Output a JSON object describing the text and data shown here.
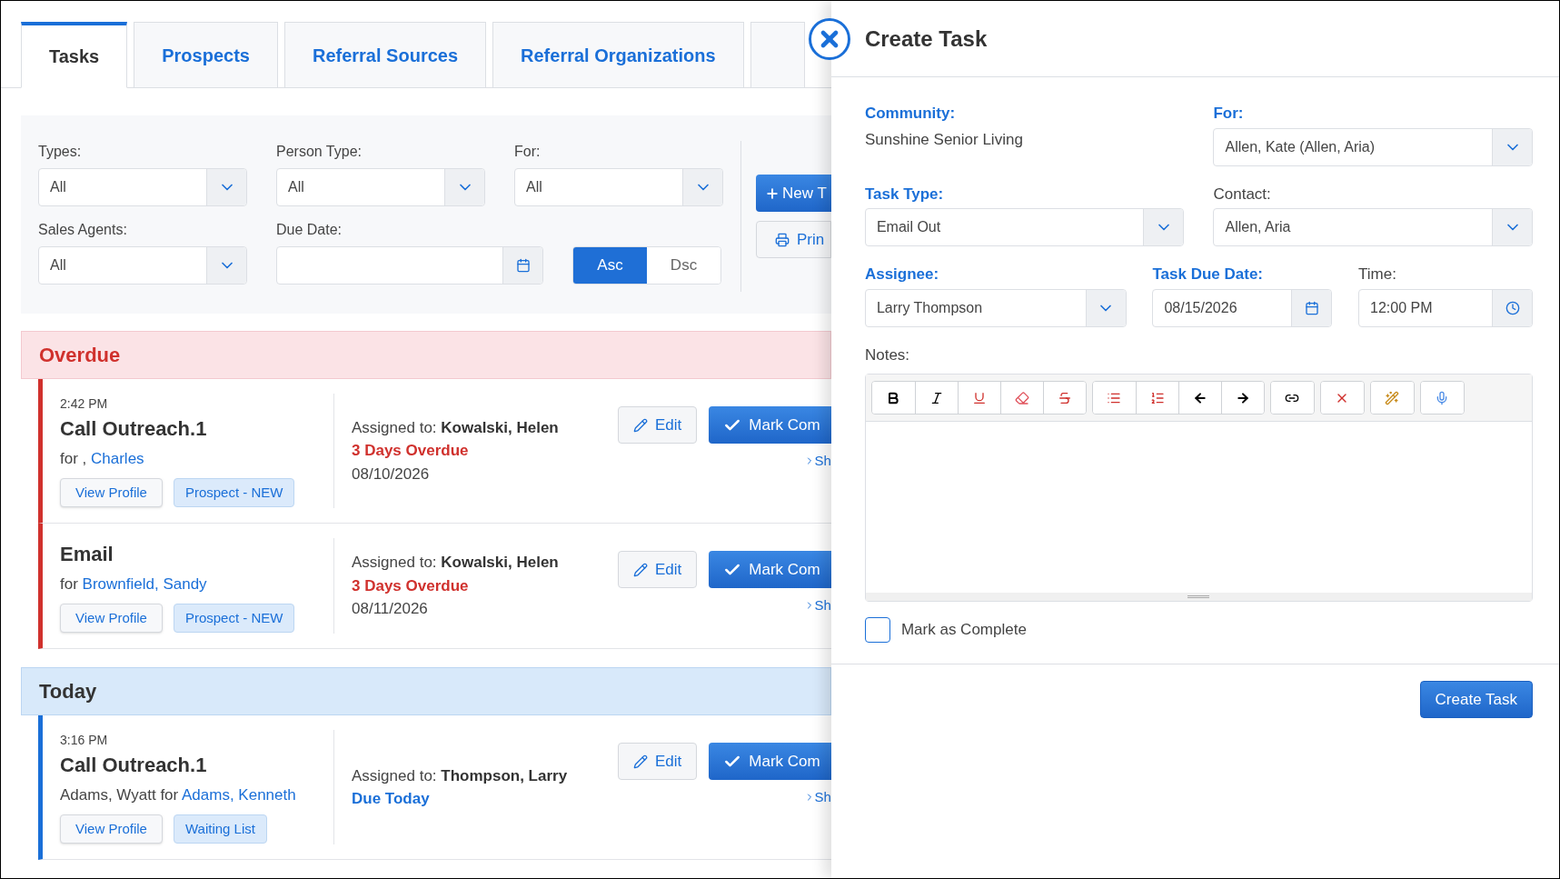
{
  "tabs": [
    {
      "label": "Tasks",
      "selected": true
    },
    {
      "label": "Prospects",
      "selected": false
    },
    {
      "label": "Referral Sources",
      "selected": false
    },
    {
      "label": "Referral Organizations",
      "selected": false
    }
  ],
  "filters": [
    {
      "kind": "select",
      "label": "Types:",
      "value": "All"
    },
    {
      "kind": "select",
      "label": "Person Type:",
      "value": "All"
    },
    {
      "kind": "select",
      "label": "For:",
      "value": "All"
    },
    {
      "kind": "select",
      "label": "Sales Agents:",
      "value": "All"
    },
    {
      "kind": "date",
      "label": "Due Date:"
    }
  ],
  "sort": [
    {
      "label": "Asc",
      "selected": true
    },
    {
      "label": "Dsc",
      "selected": false
    }
  ],
  "actions": [
    {
      "kind": "new",
      "label": "New T"
    },
    {
      "kind": "print",
      "label": "Prin"
    }
  ],
  "groups": [
    {
      "kind": "overdue",
      "title": "Overdue",
      "tasks": [
        {
          "time": "2:42 PM",
          "title": "Call Outreach.1",
          "for_text": "for , ",
          "for_link": "Charles",
          "tags": [
            {
              "kind": "button",
              "label": "View Profile"
            },
            {
              "kind": "tag",
              "label": "Prospect - NEW"
            }
          ],
          "assigned_label": "Assigned to:",
          "assignee": "Kowalski, Helen",
          "status": "3 Days Overdue",
          "date": "08/10/2026",
          "edit": "Edit",
          "complete": "Mark Com",
          "more": "Sh"
        },
        {
          "title": "Email",
          "for_text": "for ",
          "for_link": "Brownfield, Sandy",
          "tags": [
            {
              "kind": "button",
              "label": "View Profile"
            },
            {
              "kind": "tag",
              "label": "Prospect - NEW"
            }
          ],
          "assigned_label": "Assigned to:",
          "assignee": "Kowalski, Helen",
          "status": "3 Days Overdue",
          "date": "08/11/2026",
          "edit": "Edit",
          "complete": "Mark Com",
          "more": "Sh"
        }
      ]
    },
    {
      "kind": "today",
      "title": "Today",
      "tasks": [
        {
          "time": "3:16 PM",
          "title": "Call Outreach.1",
          "for_text": "Adams, Wyatt for ",
          "for_link": "Adams, Kenneth",
          "tags": [
            {
              "kind": "button",
              "label": "View Profile"
            },
            {
              "kind": "tag",
              "label": "Waiting List"
            }
          ],
          "assigned_label": "Assigned to:",
          "assignee": "Thompson, Larry",
          "status": "Due Today",
          "edit": "Edit",
          "complete": "Mark Com",
          "more": "Sh"
        }
      ]
    }
  ],
  "panel": {
    "title": "Create Task",
    "rows": [
      [
        {
          "kind": "static",
          "label": "Community:",
          "highlighted": true,
          "value": "Sunshine Senior Living"
        },
        {
          "kind": "select",
          "label": "For:",
          "highlighted": true,
          "value": "Allen, Kate (Allen, Aria)"
        }
      ],
      [
        {
          "kind": "select",
          "label": "Task Type:",
          "highlighted": true,
          "value": "Email Out"
        },
        {
          "kind": "select",
          "label": "Contact:",
          "highlighted": false,
          "value": "Allen, Aria"
        }
      ],
      [
        {
          "kind": "select",
          "label": "Assignee:",
          "highlighted": true,
          "value": "Larry Thompson"
        },
        {
          "kind": "date",
          "label": "Task Due Date:",
          "highlighted": true,
          "value": "08/15/2026"
        },
        {
          "kind": "time",
          "label": "Time:",
          "highlighted": false,
          "value": "12:00 PM"
        }
      ]
    ],
    "notes_label": "Notes:",
    "complete": {
      "label": "Mark as Complete",
      "checked": false
    },
    "submit": "Create Task"
  }
}
